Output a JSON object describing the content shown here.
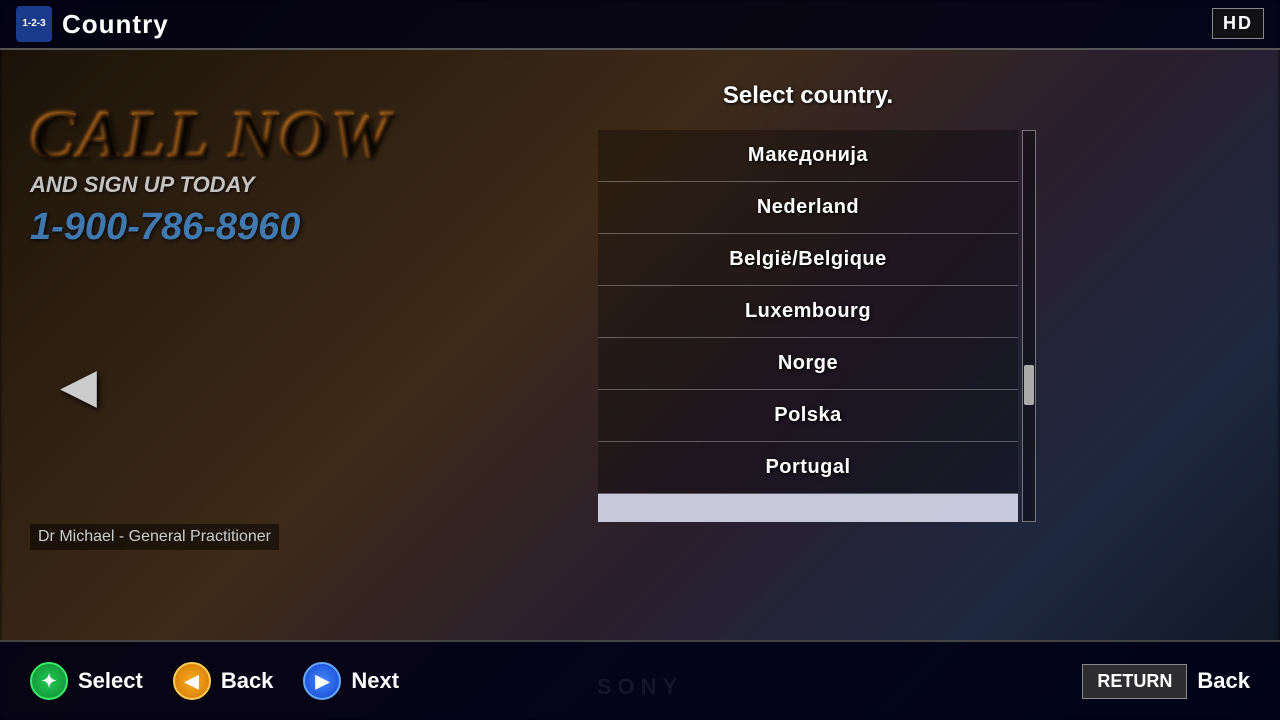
{
  "topBar": {
    "logoText": "1-2-3",
    "title": "Country",
    "hdBadge": "HD"
  },
  "callNow": {
    "title": "CALL NOW",
    "subtitle": "AND SIGN UP TODAY",
    "number": "1-900-786-8960"
  },
  "subtitle": "Dr Michael - General Practitioner",
  "countryPanel": {
    "header": "Select country.",
    "countries": [
      {
        "name": "Македонија",
        "selected": false
      },
      {
        "name": "Nederland",
        "selected": false
      },
      {
        "name": "België/Belgique",
        "selected": false
      },
      {
        "name": "Luxembourg",
        "selected": false
      },
      {
        "name": "Norge",
        "selected": false
      },
      {
        "name": "Polska",
        "selected": false
      },
      {
        "name": "Portugal",
        "selected": false
      },
      {
        "name": "",
        "selected": true
      }
    ]
  },
  "controls": {
    "select": "Select",
    "back": "Back",
    "next": "Next",
    "returnLabel": "RETURN",
    "returnText": "Back"
  },
  "sony": "SONY"
}
